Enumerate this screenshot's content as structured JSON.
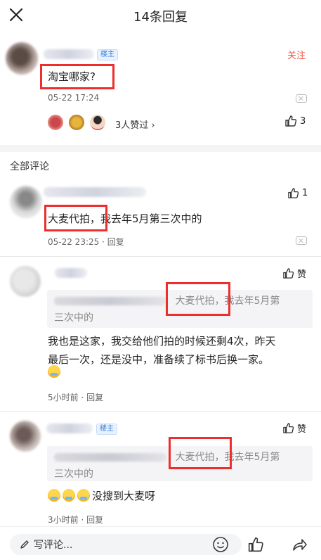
{
  "header": {
    "title": "14条回复",
    "close_icon": "close-icon"
  },
  "op": {
    "badge": "楼主",
    "follow": "关注",
    "content": "淘宝哪家?",
    "time": "05-22 17:24",
    "likers_text": "3人赞过",
    "like_count": "3"
  },
  "section_label": "全部评论",
  "comments": [
    {
      "content": "大麦代拍，我去年5月第三次中的",
      "meta": "05-22 23:25 · 回复",
      "like": "1"
    },
    {
      "quote_highlight": "大麦代拍，",
      "quote_rest": "我去年5月第",
      "quote_line2": "三次中的",
      "content_line1": "我也是这家，我交给他们拍的时候还剩4次，昨天",
      "content_line2": "最后一次，还是没中，准备续了标书后换一家。",
      "meta": "5小时前 · 回复",
      "like": "赞"
    },
    {
      "badge": "楼主",
      "quote_highlight": "大麦代拍，",
      "quote_rest": "我去年5月第",
      "quote_line2": "三次中的",
      "content": "没搜到大麦呀",
      "meta": "3小时前 · 回复",
      "like": "赞"
    }
  ],
  "bottom": {
    "input_placeholder": "写评论...",
    "icons": [
      "pencil-icon",
      "emoji-icon",
      "thumb-up-icon",
      "share-icon"
    ]
  },
  "colors": {
    "accent_red": "#f05a4a",
    "highlight_box": "#ee2d2d",
    "badge_blue": "#3a7fd8"
  }
}
